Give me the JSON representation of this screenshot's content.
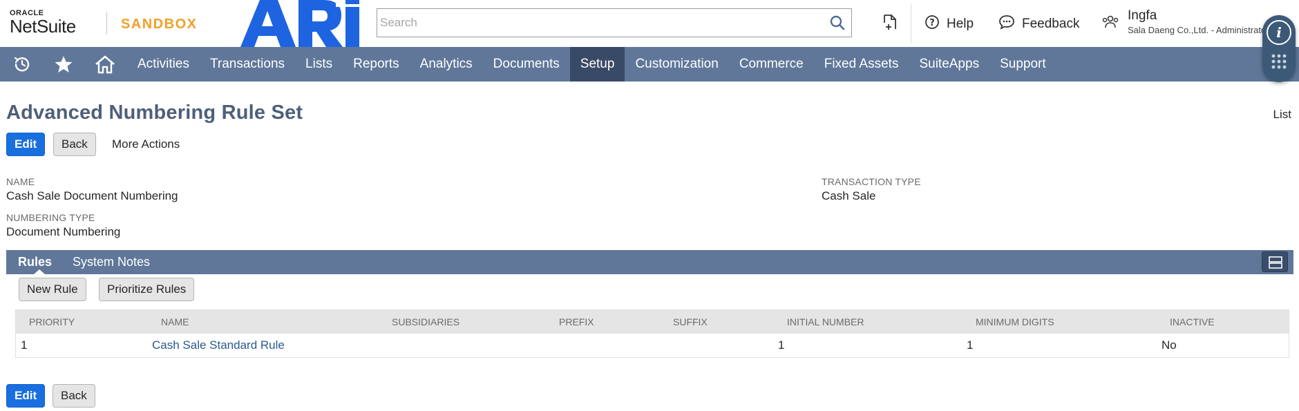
{
  "header": {
    "oracle_label": "ORACLE",
    "netsuite_label": "NetSuite",
    "sandbox_label": "SANDBOX",
    "brand_logo_text": "ARI",
    "search": {
      "placeholder": "Search",
      "value": ""
    },
    "help_label": "Help",
    "feedback_label": "Feedback",
    "user_name": "Ingfa",
    "user_role": "Sala Daeng Co.,Ltd. - Administrator"
  },
  "nav": {
    "icons": [
      "recent-records-icon",
      "star-icon",
      "home-icon"
    ],
    "items": [
      "Activities",
      "Transactions",
      "Lists",
      "Reports",
      "Analytics",
      "Documents",
      "Setup",
      "Customization",
      "Commerce",
      "Fixed Assets",
      "SuiteApps",
      "Support"
    ],
    "active_item": "Setup"
  },
  "page": {
    "title": "Advanced Numbering Rule Set",
    "list_link": "List",
    "top_buttons": {
      "edit": "Edit",
      "back": "Back",
      "more_actions": "More Actions"
    },
    "bottom_buttons": {
      "edit": "Edit",
      "back": "Back"
    }
  },
  "fields": {
    "name_label": "NAME",
    "name_value": "Cash Sale Document Numbering",
    "numbering_type_label": "NUMBERING TYPE",
    "numbering_type_value": "Document Numbering",
    "transaction_type_label": "TRANSACTION TYPE",
    "transaction_type_value": "Cash Sale"
  },
  "subtabs": {
    "items": [
      "Rules",
      "System Notes"
    ],
    "active": "Rules",
    "buttons": {
      "new_rule": "New Rule",
      "prioritize_rules": "Prioritize Rules"
    }
  },
  "rules_table": {
    "columns": [
      "PRIORITY",
      "NAME",
      "SUBSIDIARIES",
      "PREFIX",
      "SUFFIX",
      "INITIAL NUMBER",
      "MINIMUM DIGITS",
      "INACTIVE"
    ],
    "rows": [
      {
        "priority": "1",
        "name": "Cash Sale Standard Rule",
        "subsidiaries": "",
        "prefix": "",
        "suffix": "",
        "initial_number": "1",
        "minimum_digits": "1",
        "inactive": "No"
      }
    ]
  },
  "colors": {
    "nav_bg": "#607799",
    "nav_active_bg": "#384a66",
    "primary_button": "#1a6fe0",
    "title_color": "#4d5f79",
    "sandbox_orange": "#f0a028",
    "brand_blue": "#1e64e0",
    "link_color": "#295a8f"
  }
}
